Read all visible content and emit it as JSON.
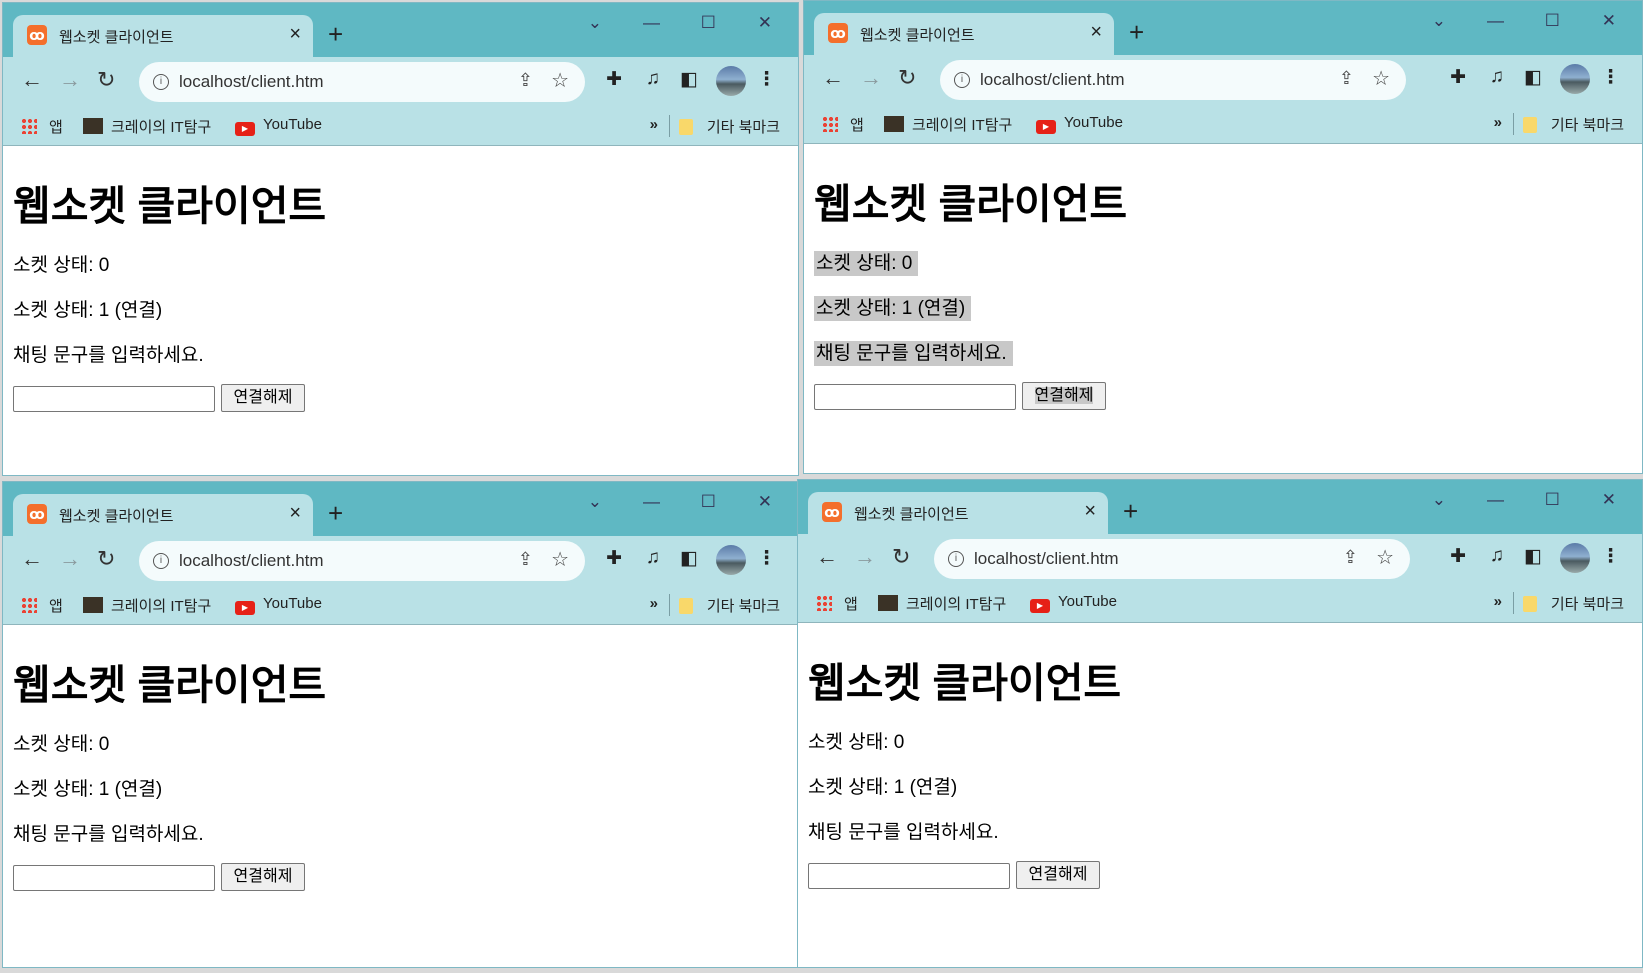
{
  "browser": {
    "tab_title": "웹소켓 클라이언트",
    "new_tab_glyph": "+",
    "url": "localhost/client.htm",
    "bookmarks": {
      "apps": "앱",
      "coding": "크레이의 IT탐구",
      "youtube": "YouTube",
      "more": "»",
      "other": "기타 북마크"
    }
  },
  "page": {
    "heading": "웹소켓 클라이언트",
    "status_initial": "소켓 상태: 0",
    "status_connected": "소켓 상태: 1 (연결)",
    "prompt": "채팅 문구를 입력하세요.",
    "input_value": "",
    "disconnect_button": "연결해제"
  },
  "colors": {
    "titlebar": "#5fb8c3",
    "toolbar": "#b9e1e6",
    "selection_highlight": "#c8c8c8"
  }
}
